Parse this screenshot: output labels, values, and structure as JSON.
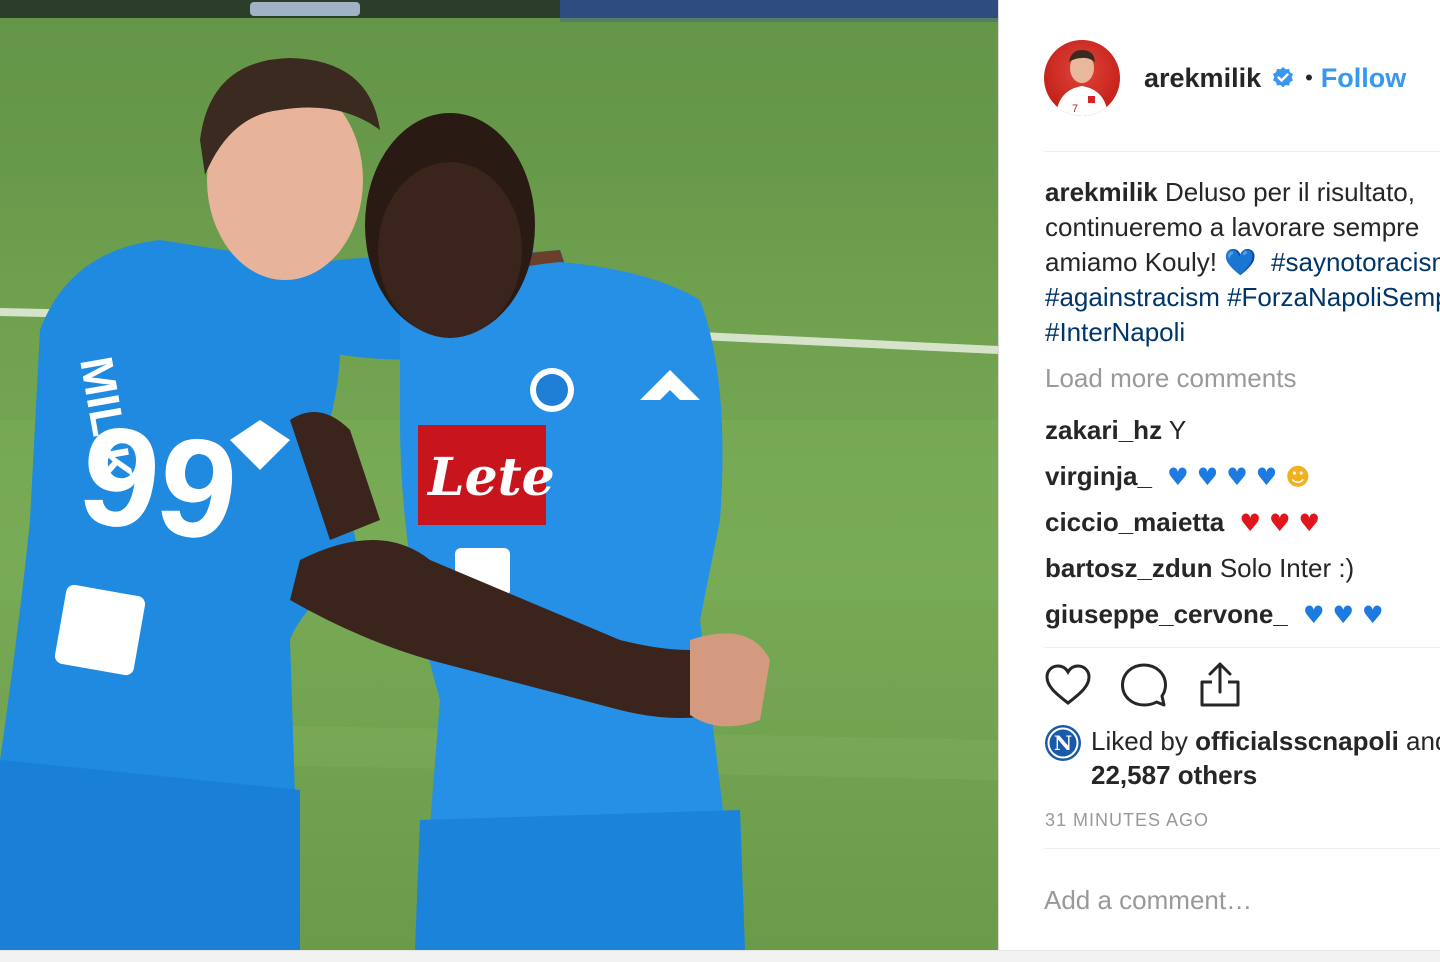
{
  "post": {
    "photo_alt": "Two Napoli players embracing on the pitch",
    "shirt_sponsor": "Lete",
    "shirt_number": "99",
    "shirt_name": "MILIK"
  },
  "header": {
    "username": "arekmilik",
    "separator": "•",
    "follow_label": "Follow",
    "avatar_number": "7"
  },
  "caption": {
    "username": "arekmilik",
    "line1": "Deluso per il risultato,",
    "line2": "continueremo a lavorare sempre",
    "line3_text": "amiamo Kouly!",
    "line3_emoji": "💙",
    "hashtags_line3": "#saynotoracism",
    "hashtags_line4": [
      "#againstracism",
      "#ForzaNapoliSempre"
    ],
    "hashtags_line5": "#InterNapoli"
  },
  "load_more_label": "Load more comments",
  "comments": [
    {
      "username": "zakari_hz",
      "text": "Y",
      "emojis": []
    },
    {
      "username": "virginja_",
      "text": "",
      "emojis": [
        "blue-heart",
        "blue-heart",
        "blue-heart",
        "blue-heart",
        "heart-eyes"
      ]
    },
    {
      "username": "ciccio_maietta",
      "text": "",
      "emojis": [
        "red-heart",
        "red-heart",
        "red-heart"
      ]
    },
    {
      "username": "bartosz_zdun",
      "text": "Solo Inter :)",
      "emojis": []
    },
    {
      "username": "giuseppe_cervone_",
      "text": "",
      "emojis": [
        "blue-heart",
        "blue-heart",
        "blue-heart"
      ]
    }
  ],
  "actions": [
    "like-icon",
    "comment-icon",
    "share-icon"
  ],
  "likes": {
    "prefix": "Liked by",
    "liker": "officialsscnapoli",
    "and": "and",
    "count_text": "22,587 others",
    "badge_letter": "N"
  },
  "timestamp": "31 MINUTES AGO",
  "add_comment_placeholder": "Add a comment…",
  "colors": {
    "link_blue": "#3897f0",
    "hashtag": "#003569",
    "muted": "#999999",
    "text": "#262626",
    "blue_heart": "#1d7ae0",
    "red_heart": "#e0161c"
  }
}
